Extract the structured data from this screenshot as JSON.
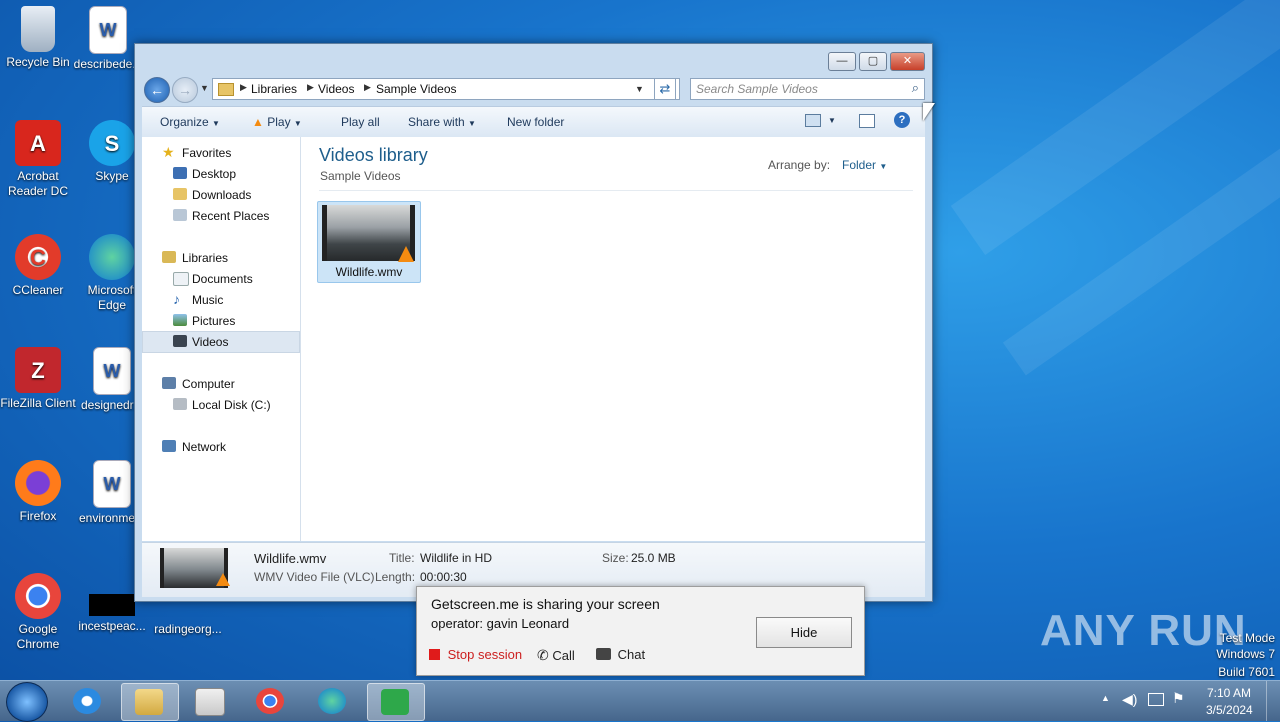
{
  "desktop": {
    "icons": [
      {
        "label": "Recycle Bin"
      },
      {
        "label": "describede..."
      },
      {
        "label": "Acrobat Reader DC"
      },
      {
        "label": "Skype"
      },
      {
        "label": "CCleaner"
      },
      {
        "label": "Microsoft Edge"
      },
      {
        "label": "FileZilla Client"
      },
      {
        "label": "designedr..."
      },
      {
        "label": "Firefox"
      },
      {
        "label": "environme..."
      },
      {
        "label": "Google Chrome"
      },
      {
        "label": "incestpeac..."
      },
      {
        "label": "radingeorg..."
      }
    ],
    "watermark": "ANY RUN",
    "test_mode": [
      "Test Mode",
      "Windows 7",
      "Build 7601"
    ]
  },
  "explorer": {
    "caption": {
      "minimize": "—",
      "maximize": "▢",
      "close": "✕"
    },
    "breadcrumb": [
      "Libraries",
      "Videos",
      "Sample Videos"
    ],
    "search_placeholder": "Search Sample Videos",
    "commands": {
      "organize": "Organize",
      "play": "Play",
      "play_all": "Play all",
      "share_with": "Share with",
      "new_folder": "New folder"
    },
    "nav": {
      "favorites": "Favorites",
      "desktop": "Desktop",
      "downloads": "Downloads",
      "recent": "Recent Places",
      "libraries": "Libraries",
      "documents": "Documents",
      "music": "Music",
      "pictures": "Pictures",
      "videos": "Videos",
      "computer": "Computer",
      "local_disk": "Local Disk (C:)",
      "network": "Network"
    },
    "content": {
      "title": "Videos library",
      "subtitle": "Sample Videos",
      "arrange_label": "Arrange by:",
      "arrange_value": "Folder",
      "file_name": "Wildlife.wmv"
    },
    "details": {
      "name": "Wildlife.wmv",
      "type": "WMV Video File (VLC)",
      "title_key": "Title:",
      "title_val": "Wildlife in HD",
      "length_key": "Length:",
      "length_val": "00:00:30",
      "size_key": "Size:",
      "size_val": "25.0 MB"
    }
  },
  "popup": {
    "line1": "Getscreen.me is sharing your screen",
    "line2": "operator: gavin Leonard",
    "hide": "Hide",
    "stop": "Stop session",
    "call": "Call",
    "chat": "Chat"
  },
  "taskbar": {
    "time": "7:10 AM",
    "date": "3/5/2024"
  }
}
